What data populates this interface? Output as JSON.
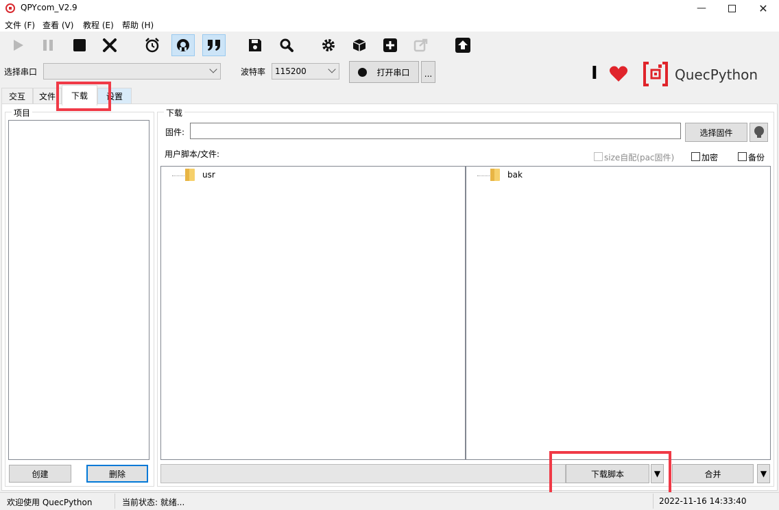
{
  "window": {
    "title": "QPYcom_V2.9"
  },
  "menu": [
    "文件 (F)",
    "查看 (V)",
    "教程 (E)",
    "帮助 (H)"
  ],
  "toolbar": {
    "icons": [
      "play-icon",
      "pause-icon",
      "stop-icon",
      "close-icon",
      "alarm-icon",
      "chat-icon",
      "quote-icon",
      "save-icon",
      "search-icon",
      "gear-icon",
      "cube-icon",
      "add-icon",
      "export-icon",
      "upload-icon"
    ],
    "active": [
      "chat-icon",
      "quote-icon"
    ]
  },
  "serial": {
    "port_label": "选择串口",
    "port_value": "",
    "baud_label": "波特率",
    "baud_value": "115200",
    "open_button": "打开串口",
    "more_button": "..."
  },
  "brand": {
    "name": "QuecPython",
    "cursor_glyph": "I"
  },
  "tabs": [
    "交互",
    "文件",
    "下载",
    "设置"
  ],
  "active_tab": "下载",
  "project": {
    "group_title": "项目",
    "create_button": "创建",
    "delete_button": "删除"
  },
  "download": {
    "group_title": "下载",
    "firmware_label": "固件:",
    "firmware_value": "",
    "select_firmware_button": "选择固件",
    "scripts_label": "用户脚本/文件:",
    "size_auto_label": "size自配(pac固件)",
    "encrypt_label": "加密",
    "backup_label": "备份",
    "left_tree": [
      {
        "name": "usr"
      }
    ],
    "right_tree": [
      {
        "name": "bak"
      }
    ],
    "download_script_button": "下载脚本",
    "merge_button": "合并",
    "dropdown_glyph": "▼"
  },
  "status": {
    "welcome": "欢迎使用 QuecPython",
    "state": "当前状态: 就绪...",
    "datetime": "2022-11-16 14:33:40"
  },
  "colors": {
    "accent_red": "#f03a47",
    "brand_red": "#e0242b",
    "active_tool": "#cce4f7"
  }
}
